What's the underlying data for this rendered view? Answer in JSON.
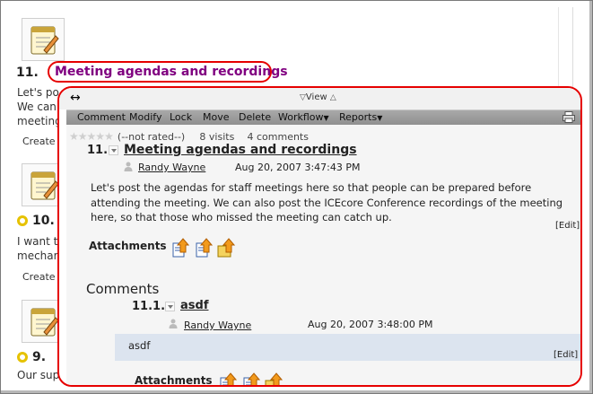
{
  "list": {
    "items": [
      {
        "number": "11.",
        "title": "Meeting agendas and recordings",
        "text_lines": [
          "Let's po",
          "We can",
          "meeting"
        ],
        "created_label": "Create"
      },
      {
        "number": "10.",
        "text_lines": [
          "I want t",
          "mechar"
        ],
        "created_label": "Create"
      },
      {
        "number": "9.",
        "text_lines": [
          "Our sup"
        ]
      }
    ]
  },
  "popup": {
    "view_label": "View",
    "toolbar": {
      "comment": "Comment",
      "modify": "Modify",
      "lock": "Lock",
      "move": "Move",
      "delete": "Delete",
      "workflow": "Workflow",
      "reports": "Reports"
    },
    "rating": {
      "stars": 5,
      "text": "(--not rated--)",
      "visits": "8 visits",
      "comments": "4 comments"
    },
    "entry": {
      "number": "11.",
      "title": "Meeting agendas and recordings",
      "author": "Randy Wayne",
      "date": "Aug 20, 2007 3:47:43 PM",
      "body": "Let's post the agendas for staff meetings here so that people can be prepared before attending the meeting. We can also post the ICEcore Conference recordings of the meeting here, so that those who missed the meeting can catch up.",
      "edit": "[Edit]",
      "attachments_label": "Attachments"
    },
    "comments_heading": "Comments",
    "comment": {
      "number": "11.1.",
      "title": "asdf",
      "author": "Randy Wayne",
      "date": "Aug 20, 2007 3:48:00 PM",
      "body": "asdf",
      "edit": "[Edit]",
      "attachments_label": "Attachments"
    }
  },
  "colors": {
    "highlight": "#e60000",
    "title_purple": "#800080",
    "toolbar": "#9b9b9b"
  }
}
